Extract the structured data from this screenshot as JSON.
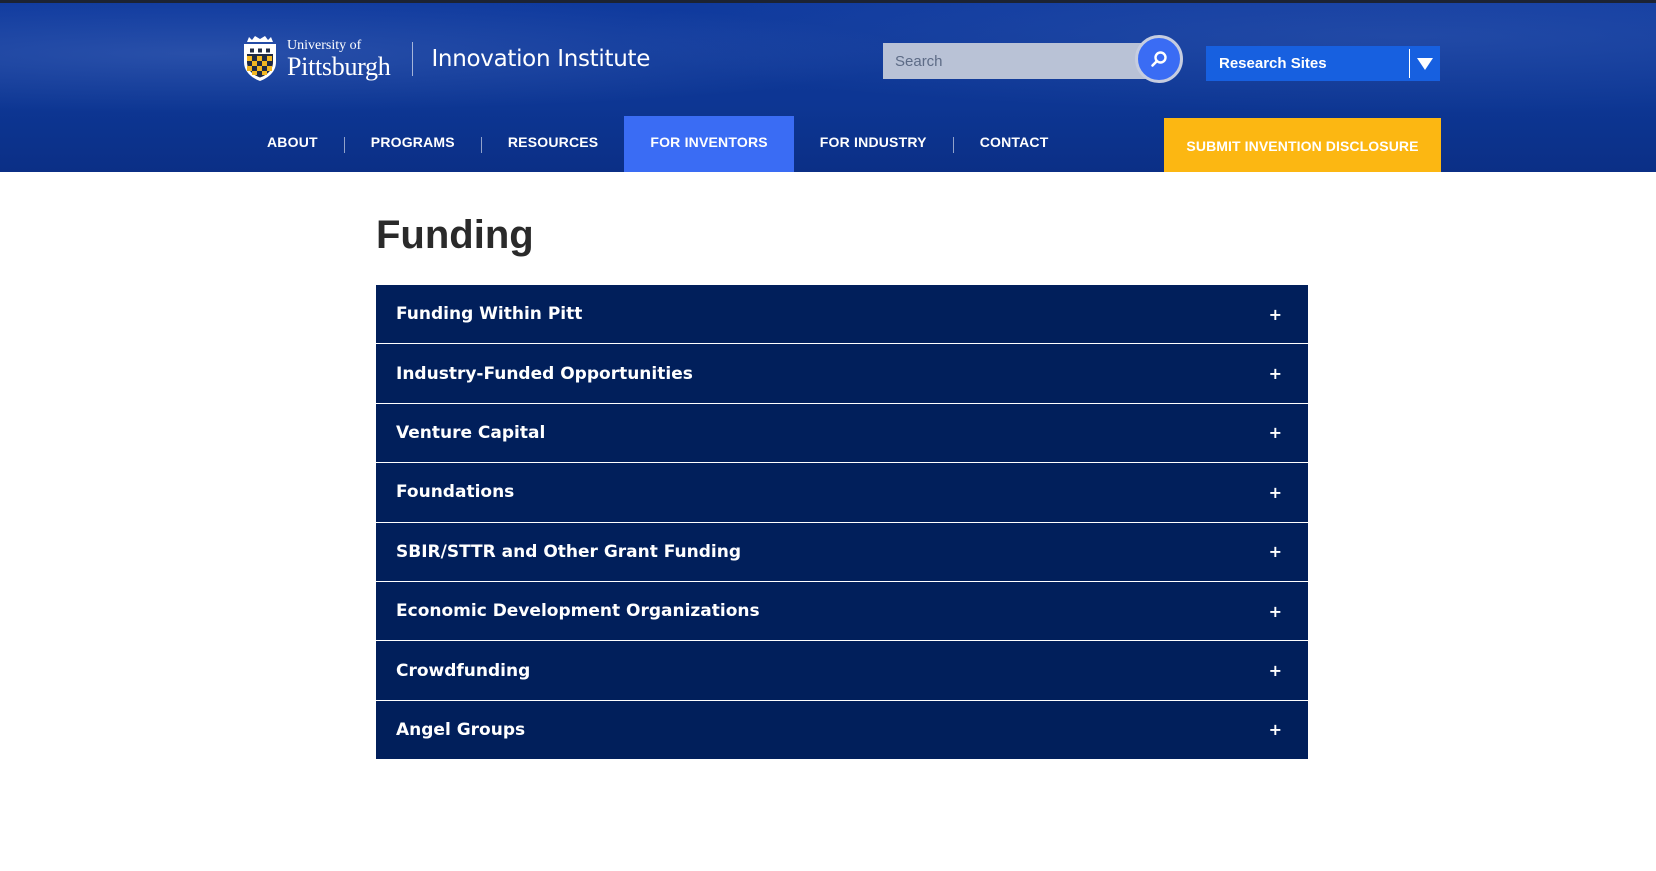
{
  "header": {
    "logo": {
      "university_line": "University of",
      "pittsburgh_line": "Pittsburgh",
      "site_name": "Innovation Institute"
    },
    "search": {
      "placeholder": "Search",
      "value": ""
    },
    "research_sites": {
      "label": "Research Sites"
    },
    "nav": [
      {
        "label": "ABOUT",
        "active": false
      },
      {
        "label": "PROGRAMS",
        "active": false
      },
      {
        "label": "RESOURCES",
        "active": false
      },
      {
        "label": "FOR INVENTORS",
        "active": true
      },
      {
        "label": "FOR INDUSTRY",
        "active": false
      },
      {
        "label": "CONTACT",
        "active": false
      }
    ],
    "submit_button": "SUBMIT INVENTION DISCLOSURE"
  },
  "main": {
    "title": "Funding",
    "accordion": [
      {
        "label": "Funding Within Pitt"
      },
      {
        "label": "Industry-Funded Opportunities"
      },
      {
        "label": "Venture Capital"
      },
      {
        "label": "Foundations"
      },
      {
        "label": "SBIR/STTR and Other Grant Funding"
      },
      {
        "label": "Economic Development Organizations"
      },
      {
        "label": "Crowdfunding"
      },
      {
        "label": "Angel Groups"
      }
    ],
    "expand_symbol": "+"
  },
  "colors": {
    "header_blue": "#0d3693",
    "active_nav": "#3a6cf4",
    "accent_gold": "#fcb712",
    "accordion_navy": "#011f5b",
    "research_blue": "#1760e0"
  }
}
